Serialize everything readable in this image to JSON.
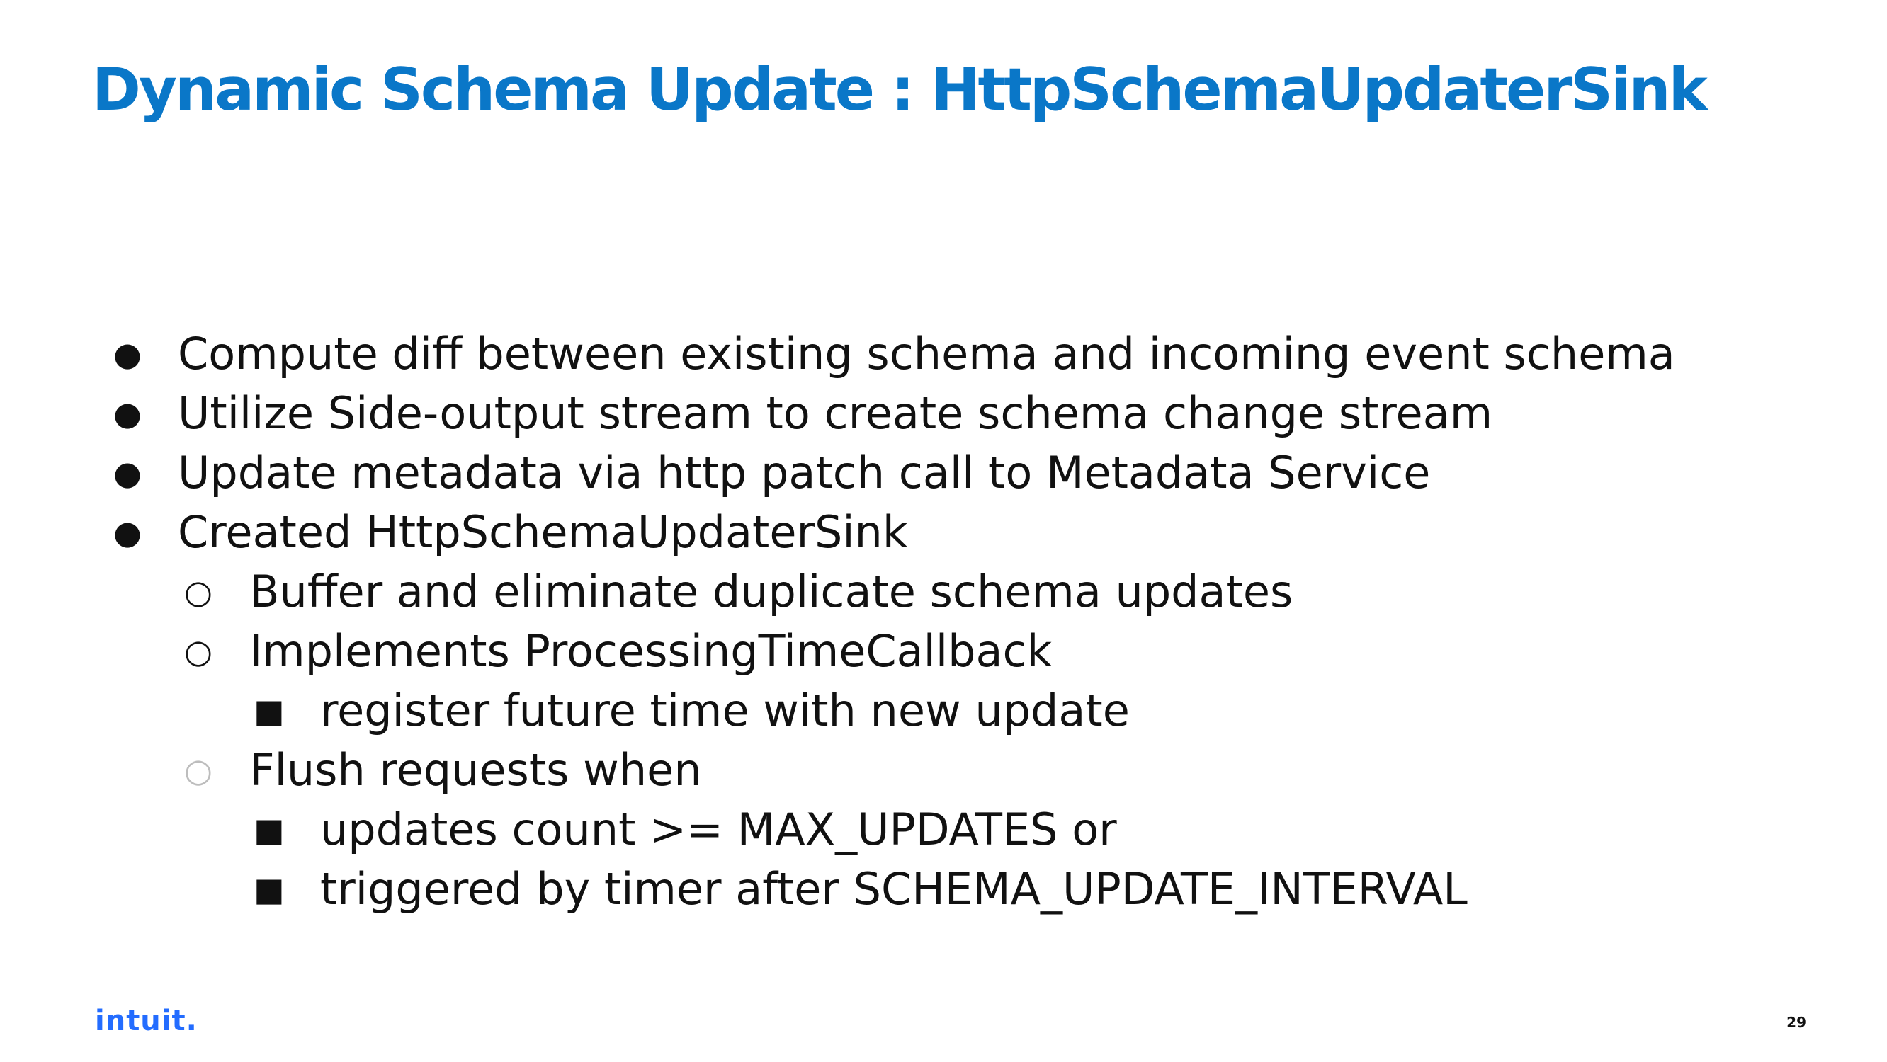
{
  "slide": {
    "title": "Dynamic Schema Update : HttpSchemaUpdaterSink",
    "bullets": [
      {
        "marker": "●",
        "text": "Compute diff between existing schema and incoming event schema"
      },
      {
        "marker": "●",
        "text": "Utilize Side-output stream to create schema change stream"
      },
      {
        "marker": "●",
        "text": "Update metadata via http patch call to Metadata Service"
      },
      {
        "marker": "●",
        "text": "Created HttpSchemaUpdaterSink"
      },
      {
        "marker": "○",
        "text": "Buffer and eliminate duplicate schema updates"
      },
      {
        "marker": "○",
        "text": "Implements ProcessingTimeCallback"
      },
      {
        "marker": "■",
        "text": "register future time with new update"
      },
      {
        "marker": "○",
        "text": "Flush requests when"
      },
      {
        "marker": "■",
        "text": "updates count >= MAX_UPDATES or"
      },
      {
        "marker": "■",
        "text": "triggered by timer after SCHEMA_UPDATE_INTERVAL"
      }
    ],
    "logo": "intuit.",
    "page_number": "29"
  },
  "colors": {
    "title": "#0a77c8",
    "logo": "#236cff",
    "body_text": "#111111"
  }
}
